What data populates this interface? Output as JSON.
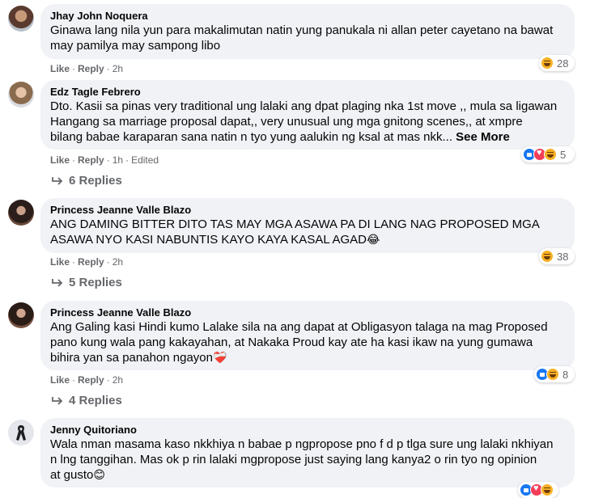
{
  "actions": {
    "like": "Like",
    "reply": "Reply",
    "edited": "Edited"
  },
  "comments": [
    {
      "author": "Jhay John Noquera",
      "lines": [
        "Ginawa lang nila yun para makalimutan natin yung panukala ni allan peter cayetano na bawat",
        "may pamilya may sampong libo"
      ],
      "time": "2h",
      "reactions": [
        "haha"
      ],
      "reaction_count": "28"
    },
    {
      "author": "Edz Tagle Febrero",
      "lines": [
        "Dto. Kasii sa pinas very traditional ung lalaki ang dpat plaging nka 1st move ,, mula sa ligawan",
        "Hangang sa marriage proposal dapat,, very unusual ung mga gnitong scenes,, at xmpre",
        "bilang babae karaparan sana natin n tyo yung aalukin ng ksal at mas nkk..."
      ],
      "see_more": "See More",
      "time": "1h",
      "edited": true,
      "reactions": [
        "like",
        "love",
        "haha"
      ],
      "reaction_count": "5",
      "replies": "6 Replies"
    },
    {
      "author": "Princess Jeanne Valle Blazo",
      "lines": [
        "ANG DAMING BITTER DITO TAS MAY MGA ASAWA PA DI LANG NAG PROPOSED MGA",
        "ASAWA NYO KASI NABUNTIS KAYO KAYA KASAL AGAD"
      ],
      "trailing_emoji": "😂",
      "time": "2h",
      "reactions": [
        "haha"
      ],
      "reaction_count": "38",
      "replies": "5 Replies"
    },
    {
      "author": "Princess Jeanne Valle Blazo",
      "lines": [
        "Ang Galing kasi Hindi kumo Lalake sila na ang dapat at Obligasyon talaga na mag Proposed",
        "pano kung wala pang kakayahan, at Nakaka Proud kay ate ha kasi ikaw na yung gumawa",
        "bihira yan sa panahon ngayon"
      ],
      "trailing_emoji": "❤️‍🩹",
      "time": "2h",
      "reactions": [
        "like",
        "haha"
      ],
      "reaction_count": "8",
      "replies": "4 Replies"
    },
    {
      "author": "Jenny Quitoriano",
      "lines": [
        "Wala nman masama kaso nkkhiya n babae p ngpropose pno f d p tlga sure ung lalaki nkhiyan",
        "n lng tanggihan. Mas ok p rin lalaki mgpropose just saying lang kanya2 o rin tyo ng opinion",
        "at gusto"
      ],
      "trailing_emoji": "😊"
    }
  ]
}
